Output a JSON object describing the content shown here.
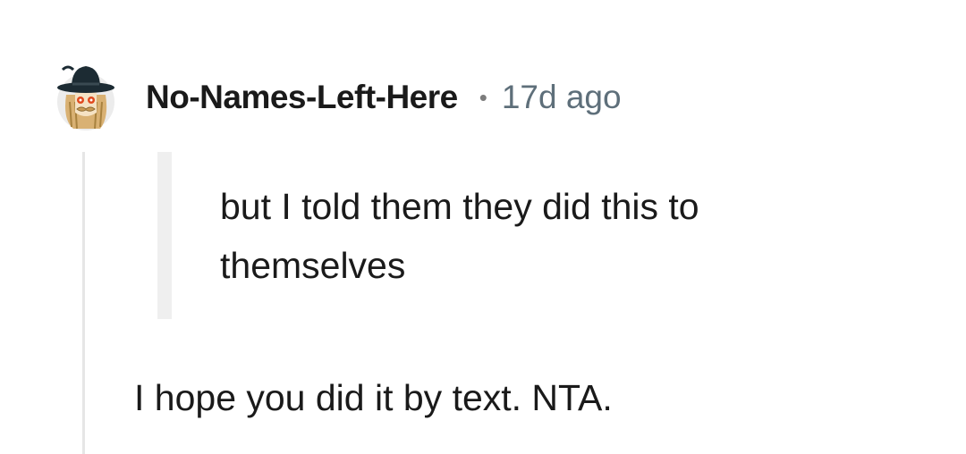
{
  "comment": {
    "username": "No-Names-Left-Here",
    "separator": "•",
    "timestamp": "17d ago",
    "quote": "but I told them they did this to themselves",
    "body": "I hope you did it by text. NTA."
  }
}
